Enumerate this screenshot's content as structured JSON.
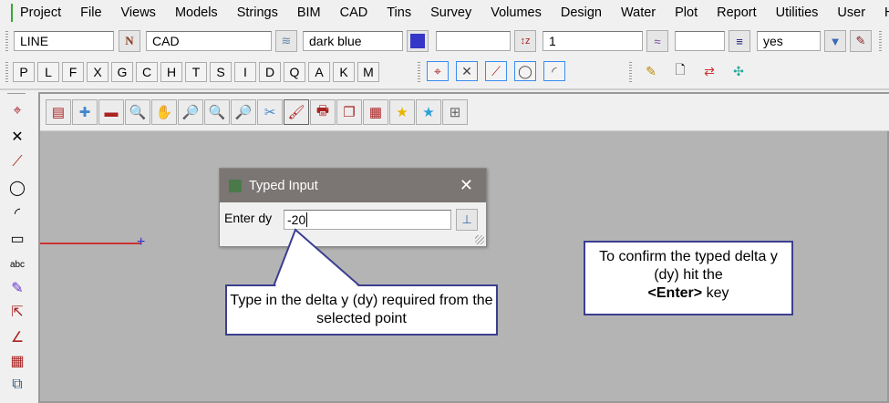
{
  "menu": {
    "items": [
      "Project",
      "File",
      "Views",
      "Models",
      "Strings",
      "BIM",
      "CAD",
      "Tins",
      "Survey",
      "Volumes",
      "Design",
      "Water",
      "Plot",
      "Report",
      "Utilities",
      "User",
      "He"
    ]
  },
  "properties": {
    "string_type": "LINE",
    "model": "CAD",
    "colour": "dark blue",
    "colour_hex": "#3535c8",
    "z_value": "",
    "weight": "1",
    "style": "",
    "breakline": "yes"
  },
  "snap_letters": [
    "P",
    "L",
    "F",
    "X",
    "G",
    "C",
    "H",
    "T",
    "S",
    "I",
    "D",
    "Q",
    "A",
    "K",
    "M"
  ],
  "dialog": {
    "title": "Typed Input",
    "label": "Enter dy",
    "value": "-20"
  },
  "callouts": {
    "input_hint": "Type in the delta y (dy) required from the selected point",
    "confirm_line1": "To confirm the typed delta y (dy) hit the",
    "confirm_key": "<Enter>",
    "confirm_line2": " key"
  },
  "colors": {
    "canvas": "#b4b4b4",
    "dialog_title": "#7b7574",
    "callout_border": "#3b3f8f"
  }
}
